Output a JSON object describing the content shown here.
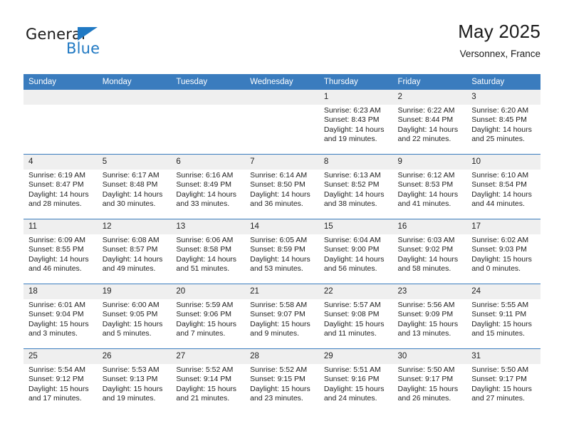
{
  "brand": {
    "word_one": "General",
    "word_two": "Blue",
    "icon": "triangle-logo-icon"
  },
  "header": {
    "title": "May 2025",
    "subtitle": "Versonnex, France"
  },
  "colors": {
    "header_blue": "#3a7cbe",
    "brand_blue": "#2079c3",
    "cell_shade": "#efefef",
    "text": "#222222"
  },
  "calendar": {
    "weekday_headers": [
      "Sunday",
      "Monday",
      "Tuesday",
      "Wednesday",
      "Thursday",
      "Friday",
      "Saturday"
    ],
    "weeks": [
      [
        {
          "day": "",
          "empty": true,
          "sunrise": "",
          "sunset": "",
          "daylight_line1": "",
          "daylight_line2": ""
        },
        {
          "day": "",
          "empty": true,
          "sunrise": "",
          "sunset": "",
          "daylight_line1": "",
          "daylight_line2": ""
        },
        {
          "day": "",
          "empty": true,
          "sunrise": "",
          "sunset": "",
          "daylight_line1": "",
          "daylight_line2": ""
        },
        {
          "day": "",
          "empty": true,
          "sunrise": "",
          "sunset": "",
          "daylight_line1": "",
          "daylight_line2": ""
        },
        {
          "day": "1",
          "empty": false,
          "sunrise": "Sunrise: 6:23 AM",
          "sunset": "Sunset: 8:43 PM",
          "daylight_line1": "Daylight: 14 hours",
          "daylight_line2": "and 19 minutes."
        },
        {
          "day": "2",
          "empty": false,
          "sunrise": "Sunrise: 6:22 AM",
          "sunset": "Sunset: 8:44 PM",
          "daylight_line1": "Daylight: 14 hours",
          "daylight_line2": "and 22 minutes."
        },
        {
          "day": "3",
          "empty": false,
          "sunrise": "Sunrise: 6:20 AM",
          "sunset": "Sunset: 8:45 PM",
          "daylight_line1": "Daylight: 14 hours",
          "daylight_line2": "and 25 minutes."
        }
      ],
      [
        {
          "day": "4",
          "empty": false,
          "sunrise": "Sunrise: 6:19 AM",
          "sunset": "Sunset: 8:47 PM",
          "daylight_line1": "Daylight: 14 hours",
          "daylight_line2": "and 28 minutes."
        },
        {
          "day": "5",
          "empty": false,
          "sunrise": "Sunrise: 6:17 AM",
          "sunset": "Sunset: 8:48 PM",
          "daylight_line1": "Daylight: 14 hours",
          "daylight_line2": "and 30 minutes."
        },
        {
          "day": "6",
          "empty": false,
          "sunrise": "Sunrise: 6:16 AM",
          "sunset": "Sunset: 8:49 PM",
          "daylight_line1": "Daylight: 14 hours",
          "daylight_line2": "and 33 minutes."
        },
        {
          "day": "7",
          "empty": false,
          "sunrise": "Sunrise: 6:14 AM",
          "sunset": "Sunset: 8:50 PM",
          "daylight_line1": "Daylight: 14 hours",
          "daylight_line2": "and 36 minutes."
        },
        {
          "day": "8",
          "empty": false,
          "sunrise": "Sunrise: 6:13 AM",
          "sunset": "Sunset: 8:52 PM",
          "daylight_line1": "Daylight: 14 hours",
          "daylight_line2": "and 38 minutes."
        },
        {
          "day": "9",
          "empty": false,
          "sunrise": "Sunrise: 6:12 AM",
          "sunset": "Sunset: 8:53 PM",
          "daylight_line1": "Daylight: 14 hours",
          "daylight_line2": "and 41 minutes."
        },
        {
          "day": "10",
          "empty": false,
          "sunrise": "Sunrise: 6:10 AM",
          "sunset": "Sunset: 8:54 PM",
          "daylight_line1": "Daylight: 14 hours",
          "daylight_line2": "and 44 minutes."
        }
      ],
      [
        {
          "day": "11",
          "empty": false,
          "sunrise": "Sunrise: 6:09 AM",
          "sunset": "Sunset: 8:55 PM",
          "daylight_line1": "Daylight: 14 hours",
          "daylight_line2": "and 46 minutes."
        },
        {
          "day": "12",
          "empty": false,
          "sunrise": "Sunrise: 6:08 AM",
          "sunset": "Sunset: 8:57 PM",
          "daylight_line1": "Daylight: 14 hours",
          "daylight_line2": "and 49 minutes."
        },
        {
          "day": "13",
          "empty": false,
          "sunrise": "Sunrise: 6:06 AM",
          "sunset": "Sunset: 8:58 PM",
          "daylight_line1": "Daylight: 14 hours",
          "daylight_line2": "and 51 minutes."
        },
        {
          "day": "14",
          "empty": false,
          "sunrise": "Sunrise: 6:05 AM",
          "sunset": "Sunset: 8:59 PM",
          "daylight_line1": "Daylight: 14 hours",
          "daylight_line2": "and 53 minutes."
        },
        {
          "day": "15",
          "empty": false,
          "sunrise": "Sunrise: 6:04 AM",
          "sunset": "Sunset: 9:00 PM",
          "daylight_line1": "Daylight: 14 hours",
          "daylight_line2": "and 56 minutes."
        },
        {
          "day": "16",
          "empty": false,
          "sunrise": "Sunrise: 6:03 AM",
          "sunset": "Sunset: 9:02 PM",
          "daylight_line1": "Daylight: 14 hours",
          "daylight_line2": "and 58 minutes."
        },
        {
          "day": "17",
          "empty": false,
          "sunrise": "Sunrise: 6:02 AM",
          "sunset": "Sunset: 9:03 PM",
          "daylight_line1": "Daylight: 15 hours",
          "daylight_line2": "and 0 minutes."
        }
      ],
      [
        {
          "day": "18",
          "empty": false,
          "sunrise": "Sunrise: 6:01 AM",
          "sunset": "Sunset: 9:04 PM",
          "daylight_line1": "Daylight: 15 hours",
          "daylight_line2": "and 3 minutes."
        },
        {
          "day": "19",
          "empty": false,
          "sunrise": "Sunrise: 6:00 AM",
          "sunset": "Sunset: 9:05 PM",
          "daylight_line1": "Daylight: 15 hours",
          "daylight_line2": "and 5 minutes."
        },
        {
          "day": "20",
          "empty": false,
          "sunrise": "Sunrise: 5:59 AM",
          "sunset": "Sunset: 9:06 PM",
          "daylight_line1": "Daylight: 15 hours",
          "daylight_line2": "and 7 minutes."
        },
        {
          "day": "21",
          "empty": false,
          "sunrise": "Sunrise: 5:58 AM",
          "sunset": "Sunset: 9:07 PM",
          "daylight_line1": "Daylight: 15 hours",
          "daylight_line2": "and 9 minutes."
        },
        {
          "day": "22",
          "empty": false,
          "sunrise": "Sunrise: 5:57 AM",
          "sunset": "Sunset: 9:08 PM",
          "daylight_line1": "Daylight: 15 hours",
          "daylight_line2": "and 11 minutes."
        },
        {
          "day": "23",
          "empty": false,
          "sunrise": "Sunrise: 5:56 AM",
          "sunset": "Sunset: 9:09 PM",
          "daylight_line1": "Daylight: 15 hours",
          "daylight_line2": "and 13 minutes."
        },
        {
          "day": "24",
          "empty": false,
          "sunrise": "Sunrise: 5:55 AM",
          "sunset": "Sunset: 9:11 PM",
          "daylight_line1": "Daylight: 15 hours",
          "daylight_line2": "and 15 minutes."
        }
      ],
      [
        {
          "day": "25",
          "empty": false,
          "sunrise": "Sunrise: 5:54 AM",
          "sunset": "Sunset: 9:12 PM",
          "daylight_line1": "Daylight: 15 hours",
          "daylight_line2": "and 17 minutes."
        },
        {
          "day": "26",
          "empty": false,
          "sunrise": "Sunrise: 5:53 AM",
          "sunset": "Sunset: 9:13 PM",
          "daylight_line1": "Daylight: 15 hours",
          "daylight_line2": "and 19 minutes."
        },
        {
          "day": "27",
          "empty": false,
          "sunrise": "Sunrise: 5:52 AM",
          "sunset": "Sunset: 9:14 PM",
          "daylight_line1": "Daylight: 15 hours",
          "daylight_line2": "and 21 minutes."
        },
        {
          "day": "28",
          "empty": false,
          "sunrise": "Sunrise: 5:52 AM",
          "sunset": "Sunset: 9:15 PM",
          "daylight_line1": "Daylight: 15 hours",
          "daylight_line2": "and 23 minutes."
        },
        {
          "day": "29",
          "empty": false,
          "sunrise": "Sunrise: 5:51 AM",
          "sunset": "Sunset: 9:16 PM",
          "daylight_line1": "Daylight: 15 hours",
          "daylight_line2": "and 24 minutes."
        },
        {
          "day": "30",
          "empty": false,
          "sunrise": "Sunrise: 5:50 AM",
          "sunset": "Sunset: 9:17 PM",
          "daylight_line1": "Daylight: 15 hours",
          "daylight_line2": "and 26 minutes."
        },
        {
          "day": "31",
          "empty": false,
          "sunrise": "Sunrise: 5:50 AM",
          "sunset": "Sunset: 9:17 PM",
          "daylight_line1": "Daylight: 15 hours",
          "daylight_line2": "and 27 minutes."
        }
      ]
    ]
  }
}
